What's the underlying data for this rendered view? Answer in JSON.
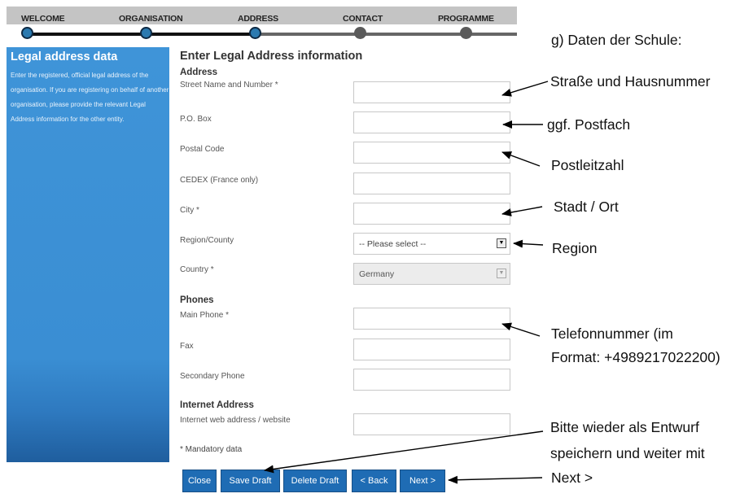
{
  "steps": [
    "WELCOME",
    "ORGANISATION",
    "ADDRESS",
    "CONTACT",
    "PROGRAMME"
  ],
  "sidebar": {
    "title": "Legal address data",
    "description": "Enter the registered, official legal address of the organisation. If you are registering on behalf of another organisation, please provide the relevant Legal Address information for the other entity."
  },
  "form": {
    "heading": "Enter Legal Address information",
    "sections": {
      "address": "Address",
      "phones": "Phones",
      "internet": "Internet Address"
    },
    "labels": {
      "street": "Street Name and Number *",
      "po_box": "P.O. Box",
      "postal_code": "Postal Code",
      "cedex": "CEDEX (France only)",
      "city": "City *",
      "region": "Region/County",
      "country": "Country *",
      "main_phone": "Main Phone *",
      "fax": "Fax",
      "secondary_phone": "Secondary Phone",
      "website": "Internet web address / website"
    },
    "region_value": "-- Please select --",
    "country_value": "Germany",
    "mandatory_note": "* Mandatory data"
  },
  "buttons": {
    "close": "Close",
    "save_draft": "Save Draft",
    "delete_draft": "Delete Draft",
    "back": "< Back",
    "next": "Next >"
  },
  "annotations": {
    "header": "g) Daten der Schule:",
    "street": "Straße und Hausnummer",
    "po_box": "ggf. Postfach",
    "postal": "Postleitzahl",
    "city": "Stadt  / Ort",
    "region": "Region",
    "phone_line1": "Telefonnummer (im",
    "phone_line2": "Format: +4989217022200)",
    "save_line1": "Bitte wieder als Entwurf",
    "save_line2": "speichern und weiter mit",
    "save_line3": "Next >"
  }
}
